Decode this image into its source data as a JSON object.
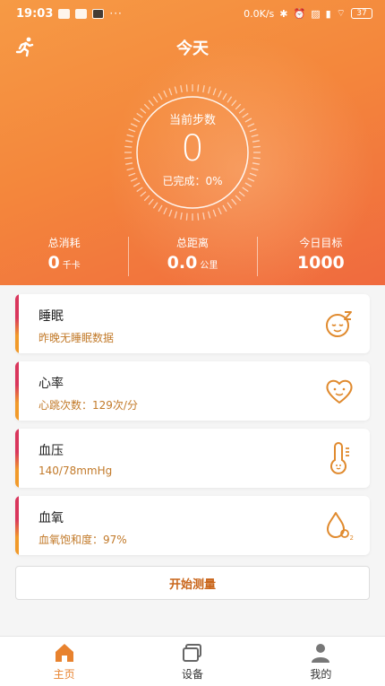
{
  "status_bar": {
    "time": "19:03",
    "dots": "···",
    "network_speed": "0.0K/s",
    "battery": "37"
  },
  "header": {
    "title": "今天"
  },
  "steps": {
    "label": "当前步数",
    "value": "0",
    "completed_label": "已完成：0%",
    "progress_fraction": 0
  },
  "stats": [
    {
      "label": "总消耗",
      "value": "0",
      "unit": "千卡"
    },
    {
      "label": "总距离",
      "value": "0.0",
      "unit": "公里"
    },
    {
      "label": "今日目标",
      "value": "1000",
      "unit": ""
    }
  ],
  "cards": [
    {
      "title": "睡眠",
      "subtitle": "昨晚无睡眠数据",
      "icon": "sleep-face-icon"
    },
    {
      "title": "心率",
      "subtitle": "心跳次数：129次/分",
      "icon": "heart-face-icon"
    },
    {
      "title": "血压",
      "subtitle": "140/78mmHg",
      "icon": "thermometer-face-icon"
    },
    {
      "title": "血氧",
      "subtitle": "血氧饱和度：97%",
      "icon": "oxygen-drop-icon"
    }
  ],
  "measure_button": "开始测量",
  "tabs": [
    {
      "label": "主页",
      "icon": "home-icon",
      "active": true
    },
    {
      "label": "设备",
      "icon": "device-icon",
      "active": false
    },
    {
      "label": "我的",
      "icon": "profile-icon",
      "active": false
    }
  ],
  "colors": {
    "hero_start": "#f69a45",
    "hero_end": "#f06a3e",
    "accent": "#e8822e",
    "card_bar_top": "#d9365c",
    "card_bar_bottom": "#f19a2a"
  }
}
